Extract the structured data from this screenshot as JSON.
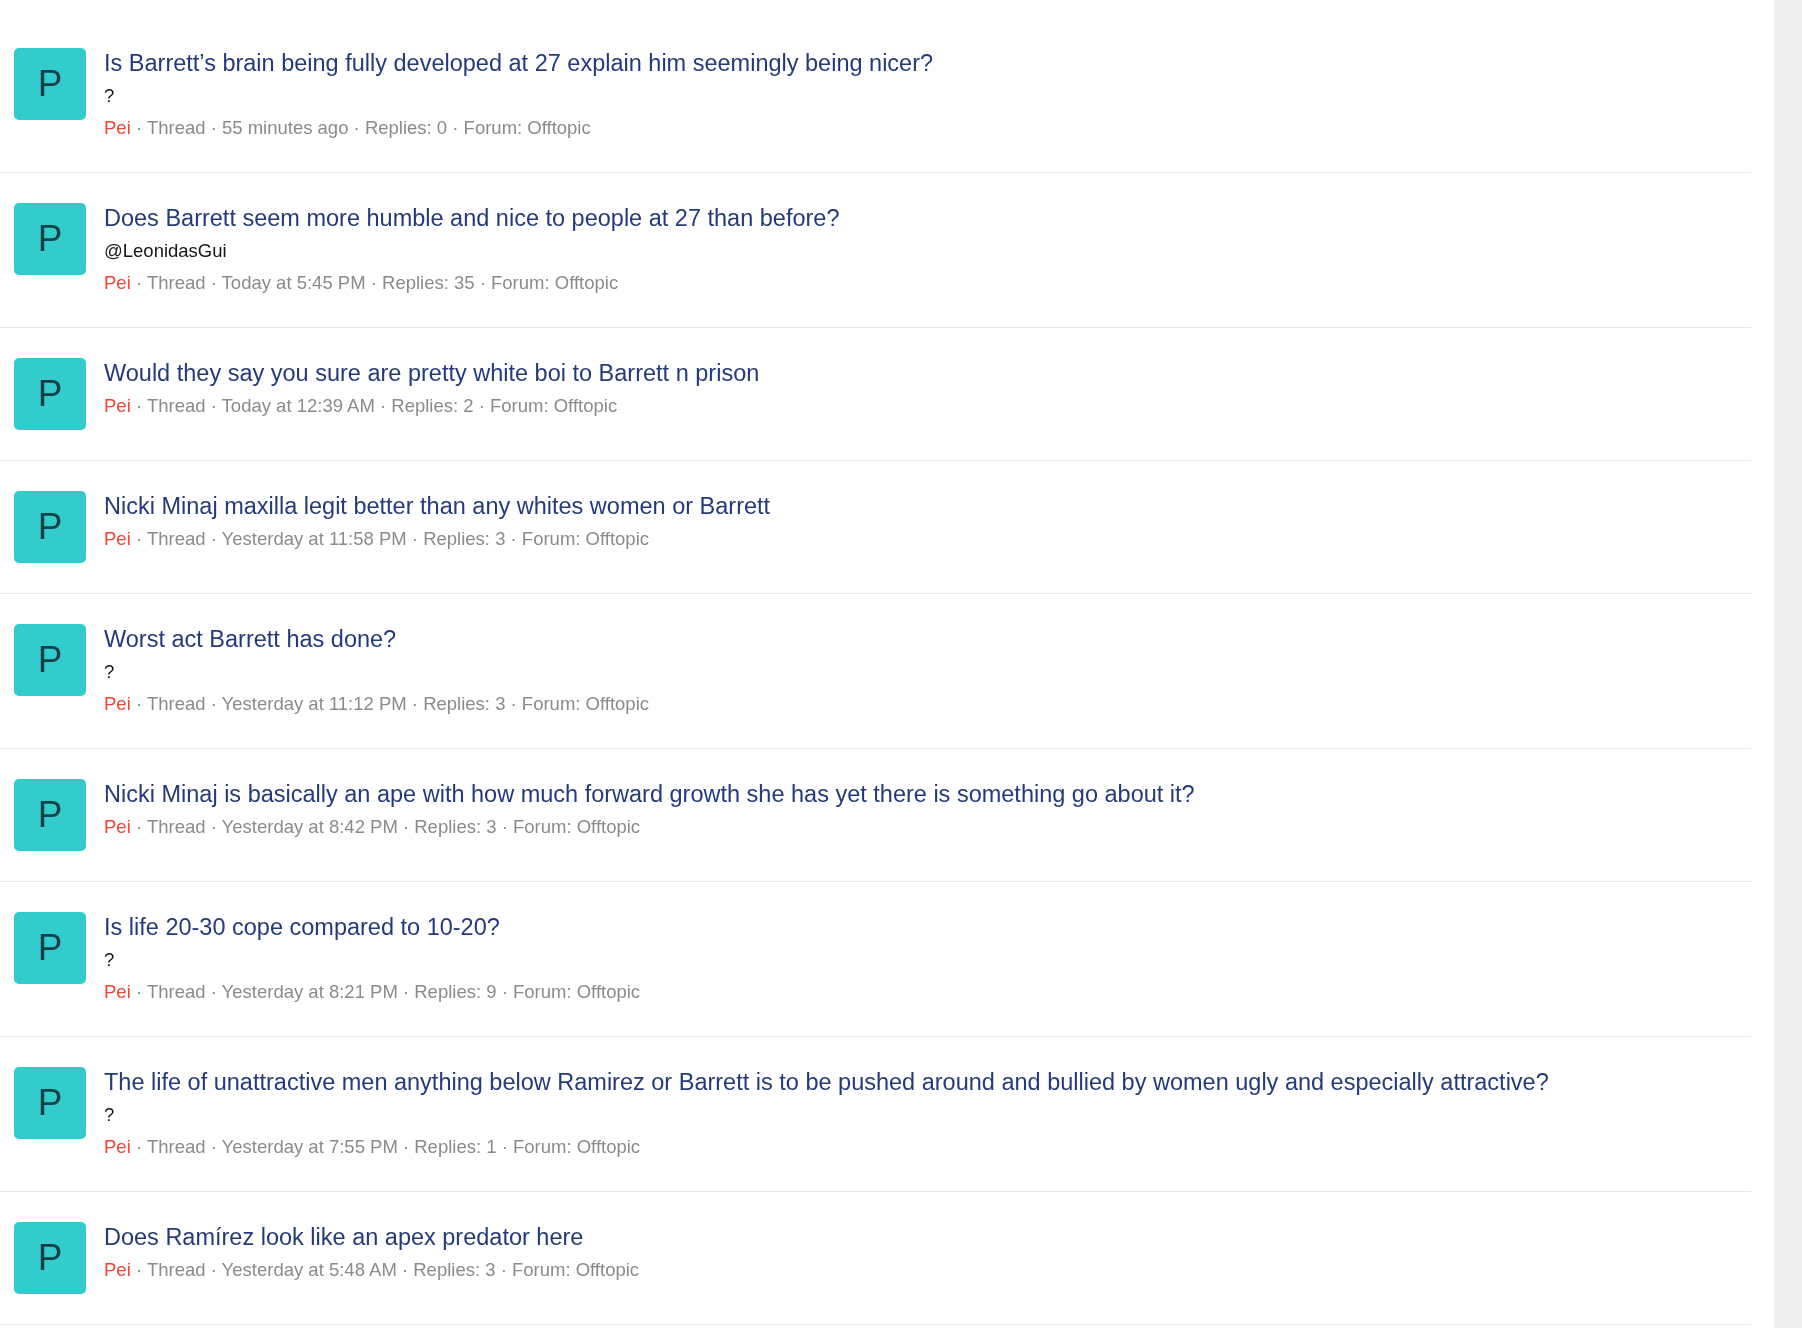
{
  "results": [
    {
      "avatar_letter": "P",
      "title": "Is Barrett’s brain being fully developed at 27 explain him seemingly being nicer?",
      "snippet": "?",
      "author": "Pei",
      "details": "· Thread · 55 minutes ago · Replies: 0 · Forum: Offtopic"
    },
    {
      "avatar_letter": "P",
      "title": "Does Barrett seem more humble and nice to people at 27 than before?",
      "snippet": "@LeonidasGui",
      "author": "Pei",
      "details": "· Thread · Today at 5:45 PM · Replies: 35 · Forum: Offtopic"
    },
    {
      "avatar_letter": "P",
      "title": "Would they say you sure are pretty white boi to Barrett n prison",
      "author": "Pei",
      "details": "· Thread · Today at 12:39 AM · Replies: 2 · Forum: Offtopic"
    },
    {
      "avatar_letter": "P",
      "title": "Nicki Minaj maxilla legit better than any whites women or Barrett",
      "author": "Pei",
      "details": "· Thread · Yesterday at 11:58 PM · Replies: 3 · Forum: Offtopic"
    },
    {
      "avatar_letter": "P",
      "title": "Worst act Barrett has done?",
      "snippet": "?",
      "author": "Pei",
      "details": "· Thread · Yesterday at 11:12 PM · Replies: 3 · Forum: Offtopic"
    },
    {
      "avatar_letter": "P",
      "title": "Nicki Minaj is basically an ape with how much forward growth she has yet there is something go about it?",
      "author": "Pei",
      "details": "· Thread · Yesterday at 8:42 PM · Replies: 3 · Forum: Offtopic"
    },
    {
      "avatar_letter": "P",
      "title": "Is life 20-30 cope compared to 10-20?",
      "snippet": "?",
      "author": "Pei",
      "details": "· Thread · Yesterday at 8:21 PM · Replies: 9 · Forum: Offtopic"
    },
    {
      "avatar_letter": "P",
      "title": "The life of unattractive men anything below Ramirez or Barrett is to be pushed around and bullied by women ugly and especially attractive?",
      "snippet": "?",
      "author": "Pei",
      "details": "· Thread · Yesterday at 7:55 PM · Replies: 1 · Forum: Offtopic"
    },
    {
      "avatar_letter": "P",
      "title": "Does Ramírez look like an apex predator here",
      "author": "Pei",
      "details": "· Thread · Yesterday at 5:48 AM · Replies: 3 · Forum: Offtopic"
    }
  ]
}
